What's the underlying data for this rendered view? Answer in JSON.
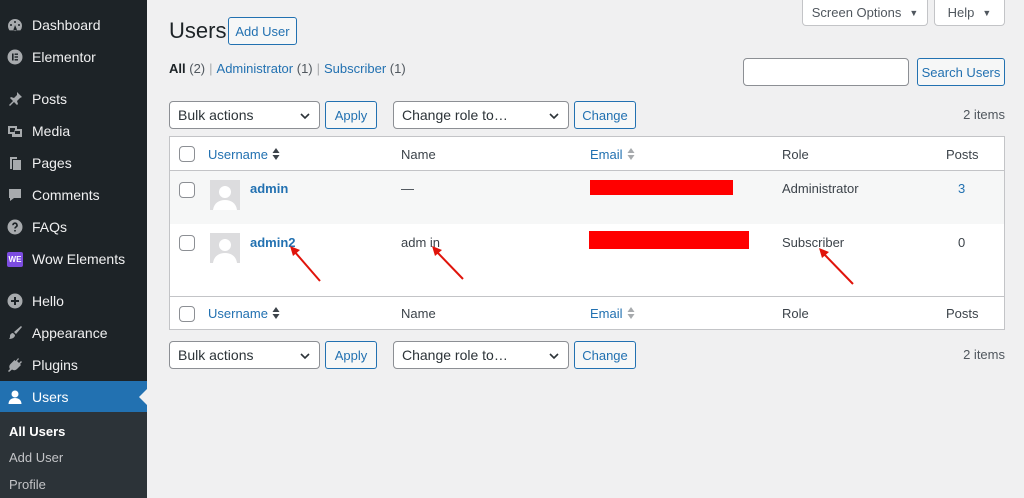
{
  "sidebar": {
    "items": [
      {
        "label": "Dashboard",
        "icon": "dashboard-icon"
      },
      {
        "label": "Elementor",
        "icon": "elementor-icon"
      },
      {
        "label": "Posts",
        "icon": "pin-icon"
      },
      {
        "label": "Media",
        "icon": "media-icon"
      },
      {
        "label": "Pages",
        "icon": "pages-icon"
      },
      {
        "label": "Comments",
        "icon": "comment-icon"
      },
      {
        "label": "FAQs",
        "icon": "help-icon"
      },
      {
        "label": "Wow Elements",
        "icon": "wow-elements-icon"
      },
      {
        "label": "Hello",
        "icon": "plus-icon"
      },
      {
        "label": "Appearance",
        "icon": "brush-icon"
      },
      {
        "label": "Plugins",
        "icon": "plugin-icon"
      },
      {
        "label": "Users",
        "icon": "user-icon"
      }
    ],
    "wow_badge": "WE",
    "submenu": [
      "All Users",
      "Add User",
      "Profile"
    ]
  },
  "topbar": {
    "screen_options": "Screen Options",
    "help": "Help"
  },
  "header": {
    "title": "Users",
    "add_user": "Add User"
  },
  "views": {
    "all": "All",
    "all_count": "(2)",
    "admin": "Administrator",
    "admin_count": "(1)",
    "subscriber": "Subscriber",
    "subscriber_count": "(1)",
    "separator": "|"
  },
  "search": {
    "value": "",
    "button": "Search Users"
  },
  "tablenav": {
    "bulk_actions": "Bulk actions",
    "apply": "Apply",
    "change_role": "Change role to…",
    "change": "Change",
    "items": "2 items"
  },
  "table": {
    "columns": {
      "username": "Username",
      "name": "Name",
      "email": "Email",
      "role": "Role",
      "posts": "Posts"
    },
    "rows": [
      {
        "username": "admin",
        "name": "—",
        "email": "",
        "role": "Administrator",
        "posts": "3"
      },
      {
        "username": "admin2",
        "name": "adm in",
        "email": "",
        "role": "Subscriber",
        "posts": "0"
      }
    ]
  },
  "colors": {
    "accent": "#2271b1",
    "sidebar_bg": "#1d2327",
    "redaction": "#ff0000",
    "annotation_arrow": "#e0140b"
  }
}
